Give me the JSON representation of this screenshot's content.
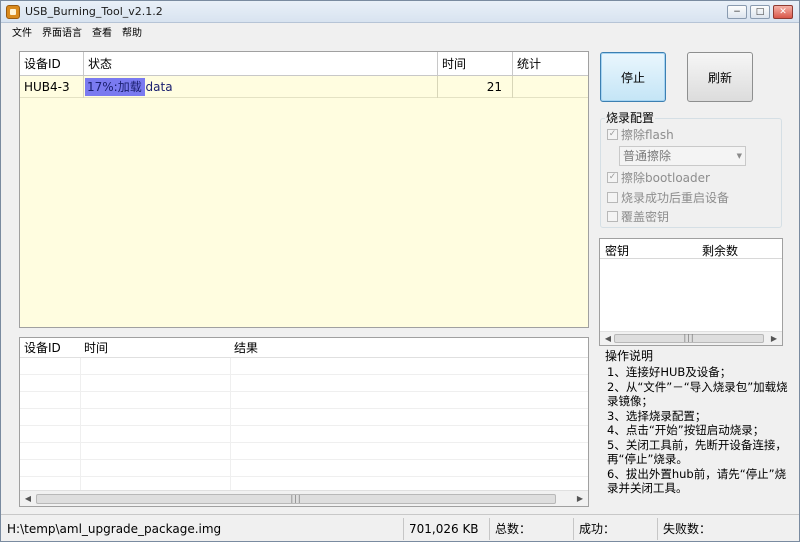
{
  "window": {
    "title": "USB_Burning_Tool_v2.1.2",
    "controls": [
      "−",
      "□",
      "✕"
    ]
  },
  "menu": [
    "文件",
    "界面语言",
    "查看",
    "帮助"
  ],
  "device_table": {
    "columns": [
      "设备ID",
      "状态",
      "时间",
      "统计"
    ],
    "rows": [
      {
        "device_id": "HUB4-3",
        "status": "17%:加载 data",
        "time": "21",
        "stat": "",
        "progress": 0.17
      }
    ]
  },
  "result_table": {
    "columns": [
      "设备ID",
      "时间",
      "结果"
    ],
    "scroll_grip": "|||"
  },
  "buttons": {
    "stop": "停止",
    "refresh": "刷新"
  },
  "burn_config": {
    "title": "烧录配置",
    "erase_flash": {
      "label": "擦除flash",
      "checked": true
    },
    "erase_mode": "普通擦除",
    "erase_bootloader": {
      "label": "擦除bootloader",
      "checked": true
    },
    "reboot_after": {
      "label": "烧录成功后重启设备",
      "checked": false
    },
    "overwrite_key": {
      "label": "覆盖密钥",
      "checked": false
    }
  },
  "key_table": {
    "columns": [
      "密钥",
      "剩余数"
    ],
    "scroll_grip": "|||"
  },
  "instructions": {
    "title": "操作说明",
    "text": "1、连接好HUB及设备；\n2、从“文件”－“导入烧录包”加载烧录镜像；\n3、选择烧录配置；\n4、点击“开始”按钮启动烧录；\n5、关闭工具前，先断开设备连接，再“停止”烧录。\n6、拔出外置hub前，请先“停止”烧录并关闭工具。"
  },
  "status_bar": {
    "path": "H:\\temp\\aml_upgrade_package.img",
    "size": "701,026 KB",
    "total_label": "总数：",
    "success_label": "成功：",
    "fail_label": "失败数："
  },
  "colors": {
    "table_body": "#fffde0",
    "progress": "#7a7af0",
    "accent_button": "#c4e5f6"
  }
}
